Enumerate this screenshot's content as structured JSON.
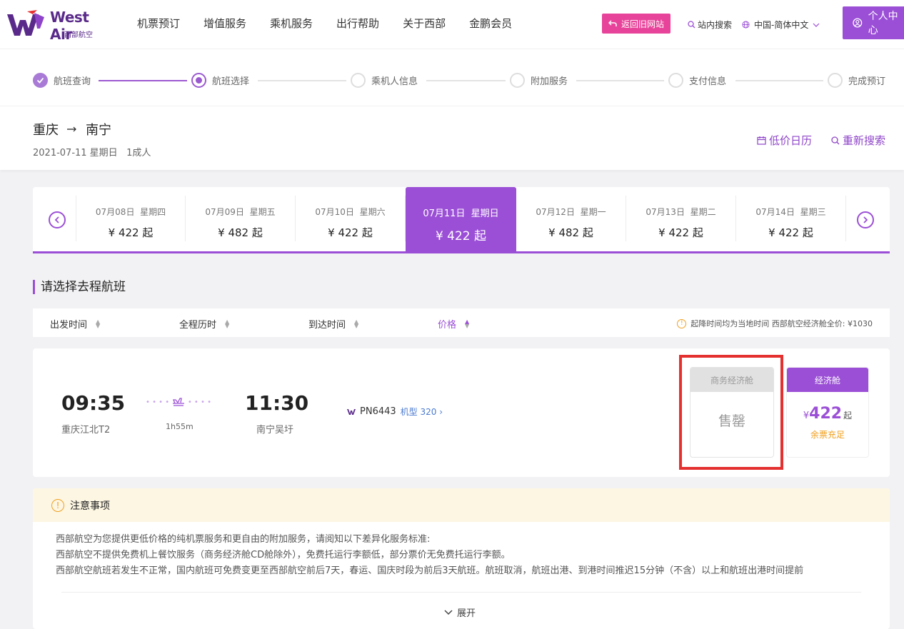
{
  "brand": {
    "name_en": "West Air",
    "name_cn": "西部航空",
    "color": "#9b4fd6",
    "accent_pink": "#e8439a"
  },
  "nav": {
    "menu": [
      "机票预订",
      "增值服务",
      "乘机服务",
      "出行帮助",
      "关于西部",
      "金鹏会员"
    ],
    "old_site": "返回旧网站",
    "site_search": "站内搜索",
    "language": "中国-简体中文",
    "user_center": "个人中心"
  },
  "steps": [
    {
      "label": "航班查询",
      "state": "done"
    },
    {
      "label": "航班选择",
      "state": "active"
    },
    {
      "label": "乘机人信息",
      "state": "todo"
    },
    {
      "label": "附加服务",
      "state": "todo"
    },
    {
      "label": "支付信息",
      "state": "todo"
    },
    {
      "label": "完成预订",
      "state": "todo"
    }
  ],
  "route": {
    "from": "重庆",
    "to": "南宁",
    "arrow": "→",
    "subtitle": "2021-07-11 星期日   1成人",
    "low_price_calendar": "低价日历",
    "research": "重新搜索"
  },
  "dates": [
    {
      "date": "07月08日  星期四",
      "price": "¥ 422 起"
    },
    {
      "date": "07月09日  星期五",
      "price": "¥ 482 起"
    },
    {
      "date": "07月10日  星期六",
      "price": "¥ 422 起"
    },
    {
      "date": "07月11日  星期日",
      "price": "¥ 422 起",
      "selected": true
    },
    {
      "date": "07月12日  星期一",
      "price": "¥ 482 起"
    },
    {
      "date": "07月13日  星期二",
      "price": "¥ 422 起"
    },
    {
      "date": "07月14日  星期三",
      "price": "¥ 422 起"
    }
  ],
  "section_title": "请选择去程航班",
  "sort": {
    "dep_time": "出发时间",
    "duration": "全程历时",
    "arr_time": "到达时间",
    "price": "价格",
    "note": "起降时间均为当地时间 西部航空经济舱全价: ¥1030"
  },
  "flight": {
    "dep_time": "09:35",
    "dep_airport": "重庆江北T2",
    "duration": "1h55m",
    "arr_time": "11:30",
    "arr_airport": "南宁吴圩",
    "flight_no": "PN6443",
    "model": "机型 320",
    "biz_cabin": {
      "label": "商务经济舱",
      "status": "售罄"
    },
    "eco_cabin": {
      "label": "经济舱",
      "currency": "¥",
      "price": "422",
      "suffix": "起",
      "stock": "余票充足"
    }
  },
  "notice": {
    "title": "注意事项",
    "lines": [
      "西部航空为您提供更低价格的纯机票服务和更自由的附加服务，请阅知以下差异化服务标准:",
      "西部航空不提供免费机上餐饮服务（商务经济舱CD舱除外），免费托运行李额低，部分票价无免费托运行李额。",
      "西部航空航班若发生不正常，国内航班可免费变更至西部航空前后7天，春运、国庆时段为前后3天航班。航班取消，航班出港、到港时间推迟15分钟（不含）以上和航班出港时间提前"
    ],
    "expand": "展开"
  }
}
